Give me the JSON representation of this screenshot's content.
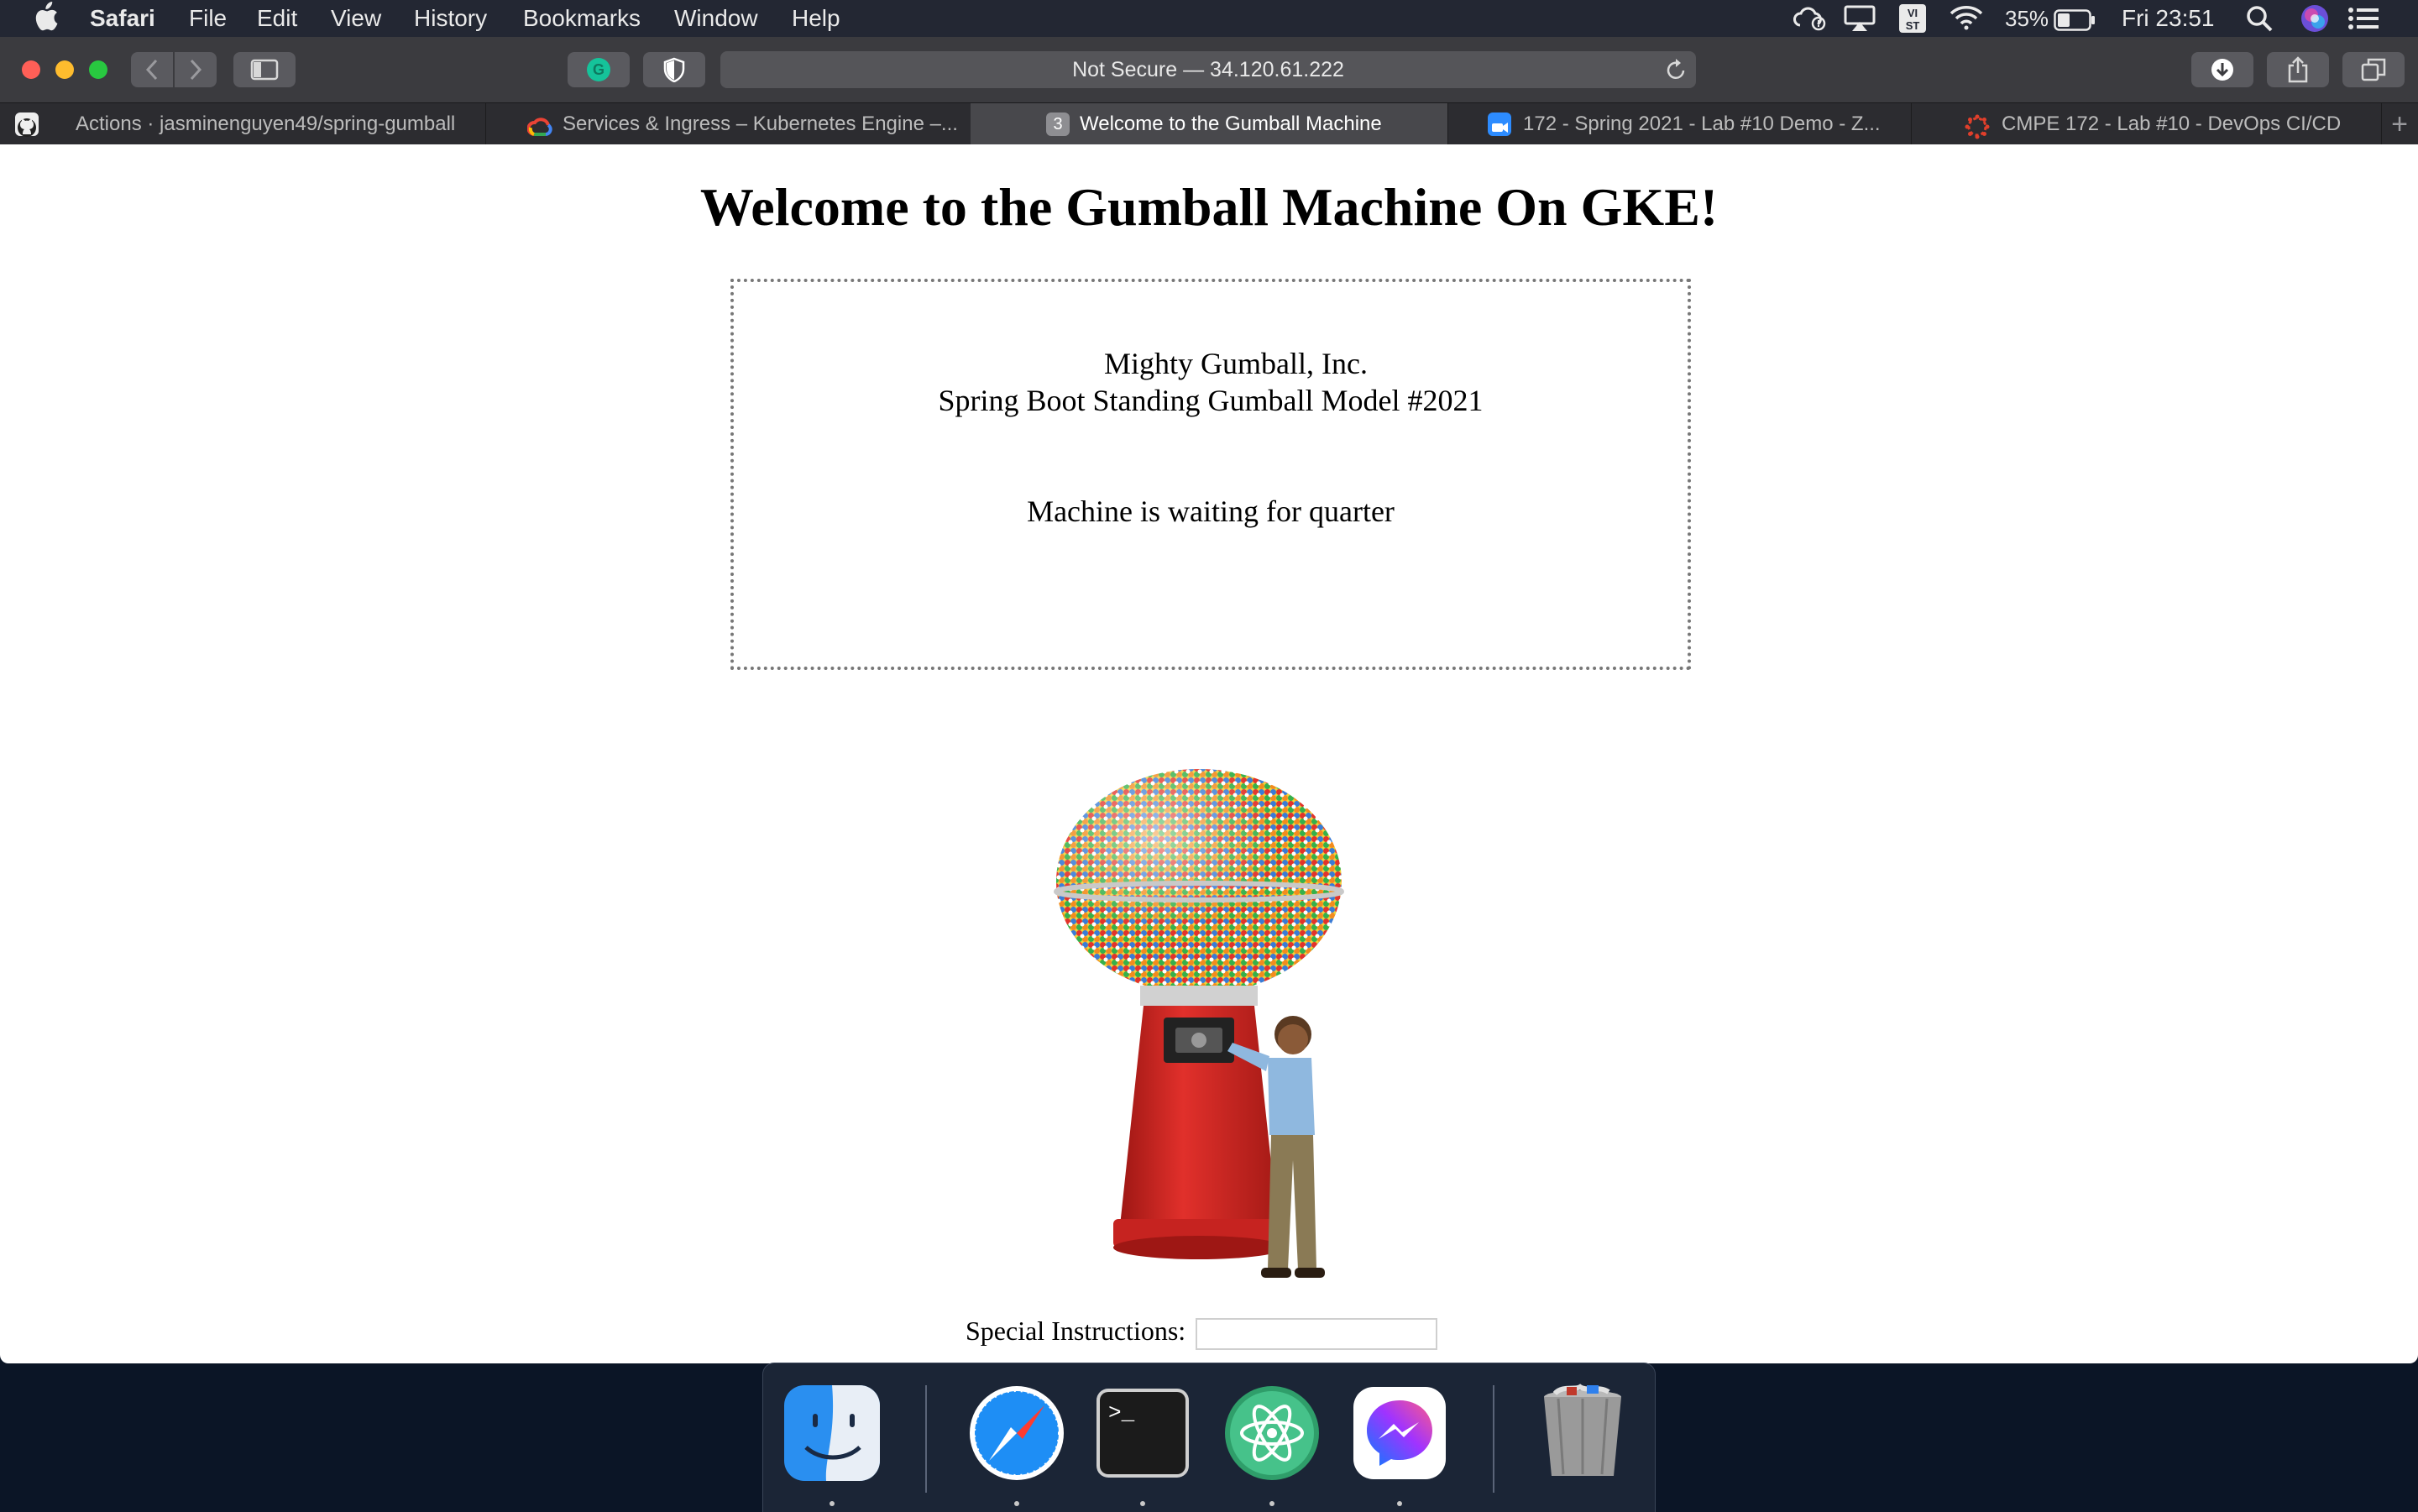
{
  "menubar": {
    "app": "Safari",
    "items": [
      "File",
      "Edit",
      "View",
      "History",
      "Bookmarks",
      "Window",
      "Help"
    ],
    "battery": "35%",
    "clock": "Fri 23:51",
    "status_icons": [
      "creative-cloud-icon",
      "airplay-icon",
      "input-vi-icon",
      "wifi-icon",
      "battery-icon",
      "search-icon",
      "siri-icon",
      "control-center-icon"
    ]
  },
  "toolbar": {
    "address": "Not Secure — 34.120.61.222"
  },
  "tabs": [
    {
      "label": "Actions · jasminenguyen49/spring-gumball",
      "icon": "github-icon"
    },
    {
      "label": "Services & Ingress – Kubernetes Engine –...",
      "icon": "google-cloud-icon"
    },
    {
      "label": "Welcome to the Gumball Machine",
      "icon": "tab-number-icon",
      "badge": "3",
      "active": true
    },
    {
      "label": "172 - Spring 2021 - Lab #10 Demo - Z...",
      "icon": "zoom-icon"
    },
    {
      "label": "CMPE 172 - Lab #10 - DevOps CI/CD",
      "icon": "canvas-icon"
    }
  ],
  "page": {
    "heading": "Welcome to the Gumball Machine On GKE!",
    "company": "Mighty Gumball, Inc.",
    "model": "Spring Boot Standing Gumball Model #2021",
    "status": "Machine is waiting for quarter",
    "instructions_label": "Special Instructions:",
    "instructions_value": ""
  },
  "dock": {
    "apps": [
      "finder-icon",
      "safari-icon",
      "terminal-icon",
      "atom-icon",
      "messenger-icon",
      "trash-icon"
    ],
    "terminal_prompt": ">_"
  },
  "colors": {
    "menubar": "#232733",
    "toolbar": "#3b3b3f",
    "active_tab": "#48484c",
    "gumball_red": "#d42a26",
    "close": "#ff5f57",
    "minimize": "#febc2e",
    "zoom": "#28c840"
  }
}
